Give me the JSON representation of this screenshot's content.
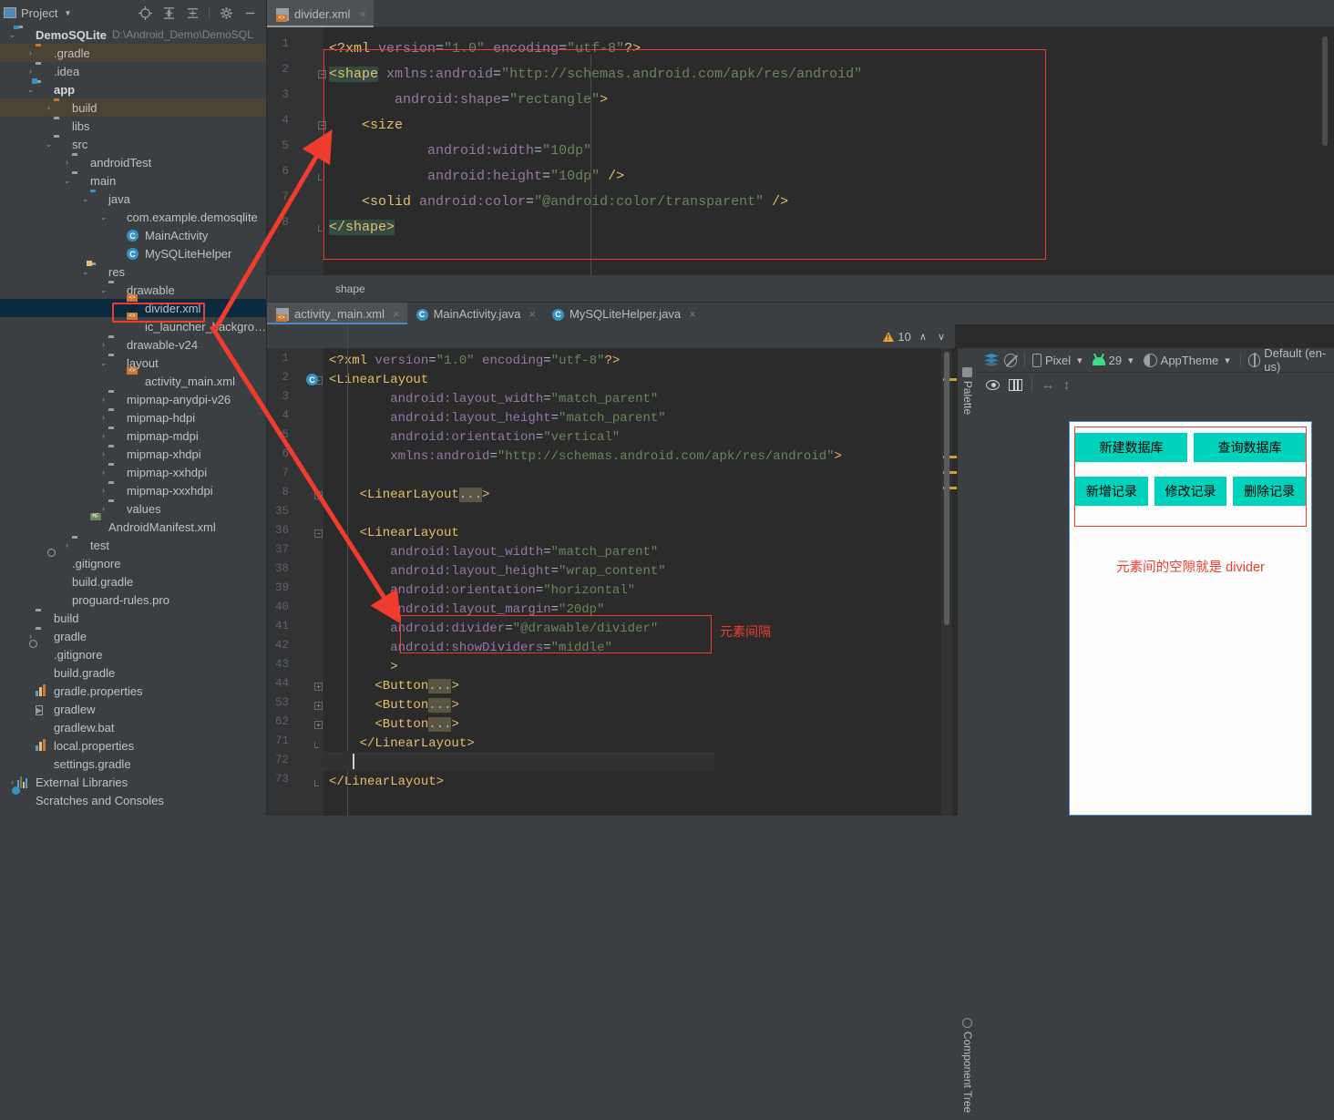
{
  "project_panel": {
    "title": "Project",
    "toolbar_icons": [
      "locate-icon",
      "expand-all-icon",
      "collapse-all-icon",
      "gear-icon",
      "minimize-icon"
    ],
    "tree": [
      {
        "depth": 0,
        "arrow": "down",
        "icon": "module-folder",
        "label": "DemoSQLite",
        "path": "D:\\Android_Demo\\DemoSQL",
        "bold": true,
        "state": "normal"
      },
      {
        "depth": 1,
        "arrow": "right",
        "icon": "folder-orange",
        "label": ".gradle",
        "state": "brown"
      },
      {
        "depth": 1,
        "arrow": "right",
        "icon": "folder",
        "label": ".idea",
        "state": "normal"
      },
      {
        "depth": 1,
        "arrow": "down",
        "icon": "module-folder",
        "label": "app",
        "bold": true,
        "state": "normal"
      },
      {
        "depth": 2,
        "arrow": "right",
        "icon": "folder-orange",
        "label": "build",
        "state": "brown"
      },
      {
        "depth": 2,
        "arrow": "none",
        "icon": "folder",
        "label": "libs",
        "state": "normal"
      },
      {
        "depth": 2,
        "arrow": "down",
        "icon": "folder",
        "label": "src",
        "state": "normal"
      },
      {
        "depth": 3,
        "arrow": "right",
        "icon": "folder",
        "label": "androidTest",
        "state": "normal"
      },
      {
        "depth": 3,
        "arrow": "down",
        "icon": "folder",
        "label": "main",
        "state": "normal"
      },
      {
        "depth": 4,
        "arrow": "down",
        "icon": "folder-blue",
        "label": "java",
        "state": "normal"
      },
      {
        "depth": 5,
        "arrow": "down",
        "icon": "package",
        "label": "com.example.demosqlite",
        "state": "normal"
      },
      {
        "depth": 6,
        "arrow": "none",
        "icon": "class",
        "label": "MainActivity",
        "state": "normal"
      },
      {
        "depth": 6,
        "arrow": "none",
        "icon": "class",
        "label": "MySQLiteHelper",
        "state": "normal"
      },
      {
        "depth": 4,
        "arrow": "down",
        "icon": "res-folder",
        "label": "res",
        "state": "normal"
      },
      {
        "depth": 5,
        "arrow": "down",
        "icon": "folder",
        "label": "drawable",
        "state": "normal"
      },
      {
        "depth": 6,
        "arrow": "none",
        "icon": "xml-file",
        "label": "divider.xml",
        "state": "selected"
      },
      {
        "depth": 6,
        "arrow": "none",
        "icon": "xml-file",
        "label": "ic_launcher_background.",
        "state": "normal"
      },
      {
        "depth": 5,
        "arrow": "right",
        "icon": "folder",
        "label": "drawable-v24",
        "state": "normal"
      },
      {
        "depth": 5,
        "arrow": "down",
        "icon": "folder",
        "label": "layout",
        "state": "normal"
      },
      {
        "depth": 6,
        "arrow": "none",
        "icon": "xml-file",
        "label": "activity_main.xml",
        "state": "normal"
      },
      {
        "depth": 5,
        "arrow": "right",
        "icon": "folder",
        "label": "mipmap-anydpi-v26",
        "state": "normal"
      },
      {
        "depth": 5,
        "arrow": "right",
        "icon": "folder",
        "label": "mipmap-hdpi",
        "state": "normal"
      },
      {
        "depth": 5,
        "arrow": "right",
        "icon": "folder",
        "label": "mipmap-mdpi",
        "state": "normal"
      },
      {
        "depth": 5,
        "arrow": "right",
        "icon": "folder",
        "label": "mipmap-xhdpi",
        "state": "normal"
      },
      {
        "depth": 5,
        "arrow": "right",
        "icon": "folder",
        "label": "mipmap-xxhdpi",
        "state": "normal"
      },
      {
        "depth": 5,
        "arrow": "right",
        "icon": "folder",
        "label": "mipmap-xxxhdpi",
        "state": "normal"
      },
      {
        "depth": 5,
        "arrow": "right",
        "icon": "folder",
        "label": "values",
        "state": "normal"
      },
      {
        "depth": 4,
        "arrow": "none",
        "icon": "manifest-file",
        "label": "AndroidManifest.xml",
        "state": "normal"
      },
      {
        "depth": 3,
        "arrow": "right",
        "icon": "folder",
        "label": "test",
        "state": "normal"
      },
      {
        "depth": 2,
        "arrow": "none",
        "icon": "gitignore-file",
        "label": ".gitignore",
        "state": "normal"
      },
      {
        "depth": 2,
        "arrow": "none",
        "icon": "gradle-file",
        "label": "build.gradle",
        "state": "normal"
      },
      {
        "depth": 2,
        "arrow": "none",
        "icon": "doc-file",
        "label": "proguard-rules.pro",
        "state": "normal"
      },
      {
        "depth": 1,
        "arrow": "none",
        "icon": "folder",
        "label": "build",
        "state": "normal"
      },
      {
        "depth": 1,
        "arrow": "right",
        "icon": "folder",
        "label": "gradle",
        "state": "normal"
      },
      {
        "depth": 1,
        "arrow": "none",
        "icon": "gitignore-file",
        "label": ".gitignore",
        "state": "normal"
      },
      {
        "depth": 1,
        "arrow": "none",
        "icon": "gradle-file",
        "label": "build.gradle",
        "state": "normal"
      },
      {
        "depth": 1,
        "arrow": "none",
        "icon": "properties-file",
        "label": "gradle.properties",
        "state": "normal"
      },
      {
        "depth": 1,
        "arrow": "none",
        "icon": "exec-file",
        "label": "gradlew",
        "state": "normal"
      },
      {
        "depth": 1,
        "arrow": "none",
        "icon": "doc-file",
        "label": "gradlew.bat",
        "state": "normal"
      },
      {
        "depth": 1,
        "arrow": "none",
        "icon": "properties-file",
        "label": "local.properties",
        "state": "normal"
      },
      {
        "depth": 1,
        "arrow": "none",
        "icon": "gradle-file",
        "label": "settings.gradle",
        "state": "normal"
      },
      {
        "depth": 0,
        "arrow": "right",
        "icon": "library-icon",
        "label": "External Libraries",
        "state": "normal"
      },
      {
        "depth": 0,
        "arrow": "none",
        "icon": "scratches-icon",
        "label": "Scratches and Consoles",
        "state": "normal"
      }
    ]
  },
  "top_editor": {
    "tab": {
      "label": "divider.xml",
      "icon": "xml-file-icon",
      "close": "×"
    },
    "breadcrumb": "shape",
    "lines": [
      {
        "n": "1",
        "fold": "",
        "segs": [
          {
            "t": "<?xml ",
            "c": "tag"
          },
          {
            "t": "version",
            "c": "attr"
          },
          {
            "t": "=",
            "c": "plain"
          },
          {
            "t": "\"1.0\"",
            "c": "str"
          },
          {
            "t": " encoding",
            "c": "attr"
          },
          {
            "t": "=",
            "c": "plain"
          },
          {
            "t": "\"utf-8\"",
            "c": "str"
          },
          {
            "t": "?>",
            "c": "tag"
          }
        ]
      },
      {
        "n": "2",
        "fold": "open",
        "segs": [
          {
            "t": "<shape",
            "c": "tag-hl"
          },
          {
            "t": " xmlns:android",
            "c": "attr"
          },
          {
            "t": "=",
            "c": "plain"
          },
          {
            "t": "\"http://schemas.android.com/apk/res/android\"",
            "c": "str"
          }
        ]
      },
      {
        "n": "3",
        "fold": "",
        "segs": [
          {
            "t": "        android:shape",
            "c": "attr"
          },
          {
            "t": "=",
            "c": "plain"
          },
          {
            "t": "\"rectangle\"",
            "c": "str"
          },
          {
            "t": ">",
            "c": "tag"
          }
        ]
      },
      {
        "n": "4",
        "fold": "open",
        "segs": [
          {
            "t": "    <size",
            "c": "tag"
          }
        ]
      },
      {
        "n": "5",
        "fold": "",
        "segs": [
          {
            "t": "            android:width",
            "c": "attr"
          },
          {
            "t": "=",
            "c": "plain"
          },
          {
            "t": "\"10dp\"",
            "c": "str"
          }
        ]
      },
      {
        "n": "6",
        "fold": "close",
        "segs": [
          {
            "t": "            android:height",
            "c": "attr"
          },
          {
            "t": "=",
            "c": "plain"
          },
          {
            "t": "\"10dp\" ",
            "c": "str"
          },
          {
            "t": "/>",
            "c": "tag"
          }
        ]
      },
      {
        "n": "7",
        "fold": "",
        "segs": [
          {
            "t": "    <solid",
            "c": "tag"
          },
          {
            "t": " android:color",
            "c": "attr"
          },
          {
            "t": "=",
            "c": "plain"
          },
          {
            "t": "\"@android:color/transparent\" ",
            "c": "str"
          },
          {
            "t": "/>",
            "c": "tag"
          }
        ]
      },
      {
        "n": "8",
        "fold": "close",
        "segs": [
          {
            "t": "</shape>",
            "c": "tag-hl"
          }
        ]
      }
    ]
  },
  "bottom_editor": {
    "tabs": [
      {
        "label": "activity_main.xml",
        "icon": "xml-file-icon",
        "active": true,
        "close": "×"
      },
      {
        "label": "MainActivity.java",
        "icon": "class-icon",
        "active": false,
        "close": "×"
      },
      {
        "label": "MySQLiteHelper.java",
        "icon": "class-icon",
        "active": false,
        "close": "×"
      }
    ],
    "warning_count": "10",
    "up_chevron": "∧",
    "down_chevron": "∨",
    "annotation": "元素间隔",
    "lines": [
      {
        "n": "1",
        "fold": "",
        "mark": "",
        "segs": [
          {
            "t": "<?xml ",
            "c": "tag"
          },
          {
            "t": "version",
            "c": "attr"
          },
          {
            "t": "=",
            "c": "plain"
          },
          {
            "t": "\"1.0\"",
            "c": "str"
          },
          {
            "t": " encoding",
            "c": "attr"
          },
          {
            "t": "=",
            "c": "plain"
          },
          {
            "t": "\"utf-8\"",
            "c": "str"
          },
          {
            "t": "?>",
            "c": "tag"
          }
        ]
      },
      {
        "n": "2",
        "fold": "open",
        "mark": "c",
        "segs": [
          {
            "t": "<LinearLayout",
            "c": "tag"
          }
        ]
      },
      {
        "n": "3",
        "fold": "",
        "mark": "",
        "segs": [
          {
            "t": "        android:layout_width",
            "c": "attr"
          },
          {
            "t": "=",
            "c": "plain"
          },
          {
            "t": "\"match_parent\"",
            "c": "str"
          }
        ]
      },
      {
        "n": "4",
        "fold": "",
        "mark": "",
        "segs": [
          {
            "t": "        android:layout_height",
            "c": "attr"
          },
          {
            "t": "=",
            "c": "plain"
          },
          {
            "t": "\"match_parent\"",
            "c": "str"
          }
        ]
      },
      {
        "n": "5",
        "fold": "",
        "mark": "",
        "segs": [
          {
            "t": "        android:orientation",
            "c": "attr"
          },
          {
            "t": "=",
            "c": "plain"
          },
          {
            "t": "\"vertical\"",
            "c": "str"
          }
        ]
      },
      {
        "n": "6",
        "fold": "",
        "mark": "",
        "segs": [
          {
            "t": "        xmlns:android",
            "c": "attr"
          },
          {
            "t": "=",
            "c": "plain"
          },
          {
            "t": "\"http://schemas.android.com/apk/res/android\"",
            "c": "str"
          },
          {
            "t": ">",
            "c": "tag"
          }
        ]
      },
      {
        "n": "7",
        "fold": "",
        "mark": "",
        "segs": []
      },
      {
        "n": "8",
        "fold": "plus",
        "mark": "",
        "segs": [
          {
            "t": "    <LinearLayout",
            "c": "tag"
          },
          {
            "t": "...",
            "c": "folded"
          },
          {
            "t": ">",
            "c": "tag"
          }
        ]
      },
      {
        "n": "35",
        "fold": "",
        "mark": "",
        "segs": []
      },
      {
        "n": "36",
        "fold": "open",
        "mark": "",
        "segs": [
          {
            "t": "    <LinearLayout",
            "c": "tag"
          }
        ]
      },
      {
        "n": "37",
        "fold": "",
        "mark": "",
        "segs": [
          {
            "t": "        android:layout_width",
            "c": "attr"
          },
          {
            "t": "=",
            "c": "plain"
          },
          {
            "t": "\"match_parent\"",
            "c": "str"
          }
        ]
      },
      {
        "n": "38",
        "fold": "",
        "mark": "",
        "segs": [
          {
            "t": "        android:layout_height",
            "c": "attr"
          },
          {
            "t": "=",
            "c": "plain"
          },
          {
            "t": "\"wrap_content\"",
            "c": "str"
          }
        ]
      },
      {
        "n": "39",
        "fold": "",
        "mark": "",
        "segs": [
          {
            "t": "        android:orientation",
            "c": "attr"
          },
          {
            "t": "=",
            "c": "plain"
          },
          {
            "t": "\"horizontal\"",
            "c": "str"
          }
        ]
      },
      {
        "n": "40",
        "fold": "",
        "mark": "",
        "segs": [
          {
            "t": "        android:layout_margin",
            "c": "attr"
          },
          {
            "t": "=",
            "c": "plain"
          },
          {
            "t": "\"20dp\"",
            "c": "str"
          }
        ]
      },
      {
        "n": "41",
        "fold": "",
        "mark": "",
        "segs": [
          {
            "t": "        android:divider",
            "c": "attr"
          },
          {
            "t": "=",
            "c": "plain"
          },
          {
            "t": "\"@drawable/divider\"",
            "c": "str"
          }
        ]
      },
      {
        "n": "42",
        "fold": "",
        "mark": "",
        "segs": [
          {
            "t": "        android:showDividers",
            "c": "attr"
          },
          {
            "t": "=",
            "c": "plain"
          },
          {
            "t": "\"middle\"",
            "c": "str"
          }
        ]
      },
      {
        "n": "43",
        "fold": "",
        "mark": "",
        "segs": [
          {
            "t": "        >",
            "c": "tag"
          }
        ]
      },
      {
        "n": "44",
        "fold": "plus",
        "mark": "",
        "segs": [
          {
            "t": "      <Button",
            "c": "tag"
          },
          {
            "t": "...",
            "c": "folded"
          },
          {
            "t": ">",
            "c": "tag"
          }
        ]
      },
      {
        "n": "53",
        "fold": "plus",
        "mark": "",
        "segs": [
          {
            "t": "      <Button",
            "c": "tag"
          },
          {
            "t": "...",
            "c": "folded"
          },
          {
            "t": ">",
            "c": "tag"
          }
        ]
      },
      {
        "n": "62",
        "fold": "plus",
        "mark": "",
        "segs": [
          {
            "t": "      <Button",
            "c": "tag"
          },
          {
            "t": "...",
            "c": "folded"
          },
          {
            "t": ">",
            "c": "tag"
          }
        ]
      },
      {
        "n": "71",
        "fold": "close",
        "mark": "",
        "segs": [
          {
            "t": "    </LinearLayout>",
            "c": "tag"
          }
        ]
      },
      {
        "n": "72",
        "fold": "",
        "mark": "",
        "segs": []
      },
      {
        "n": "73",
        "fold": "close",
        "mark": "",
        "segs": [
          {
            "t": "</LinearLayout>",
            "c": "tag"
          }
        ]
      }
    ]
  },
  "rails": {
    "palette_label": "Palette",
    "component_tree_label": "Component Tree"
  },
  "preview": {
    "toolbar": {
      "design_icon": "layers-icon",
      "blueprint_icon": "no-blueprint-icon",
      "device": "Pixel",
      "api": "29",
      "theme": "AppTheme",
      "locale": "Default (en-us)"
    },
    "toolbar2": {
      "eye_icon": "eye-icon",
      "columns_icon": "columns-icon",
      "width_icon": "horizontal-resize-icon",
      "height_icon": "vertical-resize-icon"
    },
    "buttons_row1": [
      "新建数据库",
      "查询数据库"
    ],
    "buttons_row2": [
      "新增记录",
      "修改记录",
      "删除记录"
    ],
    "note": "元素间的空隙就是 divider",
    "button_color": "#00d2bb",
    "note_color": "#f03c2e"
  }
}
